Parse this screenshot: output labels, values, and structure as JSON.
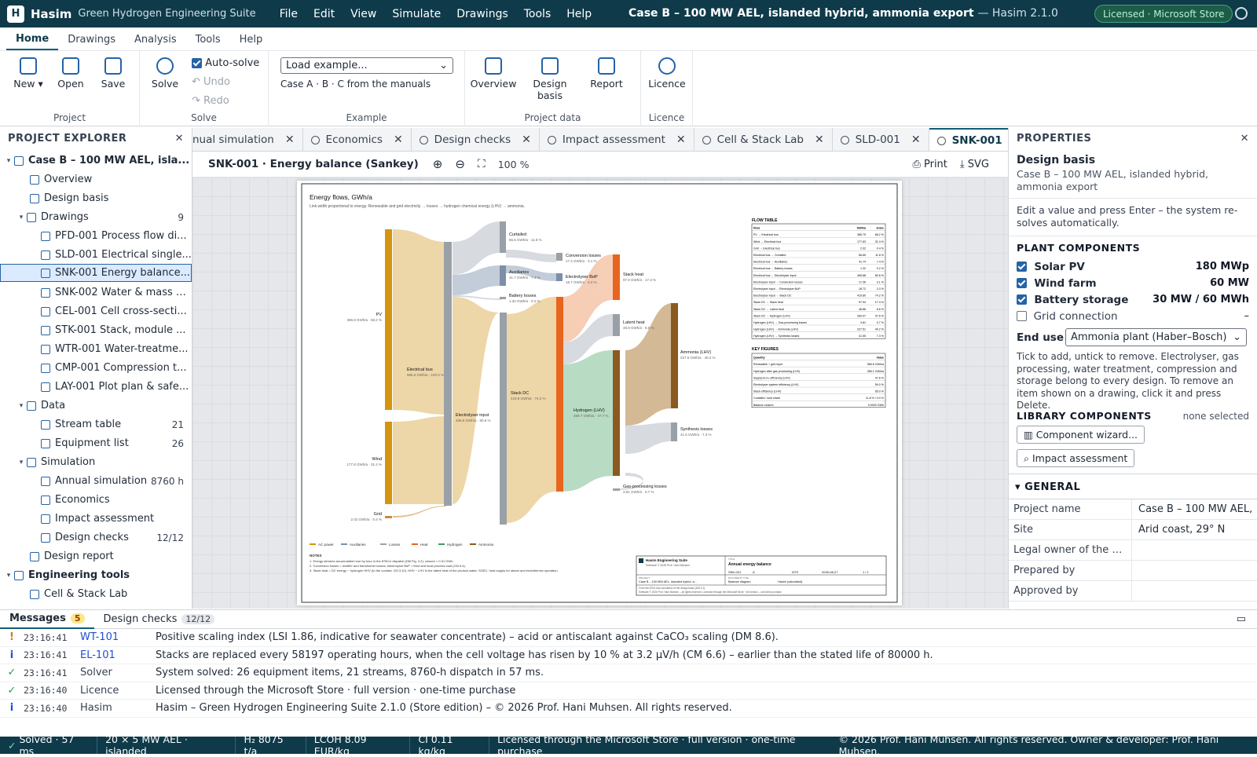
{
  "app": {
    "logo_letter": "H",
    "name": "Hasim",
    "subtitle": "Green Hydrogen Engineering Suite",
    "window_title": "Case B – 100 MW AEL, islanded hybrid, ammonia export",
    "version": "— Hasim 2.1.0",
    "license_badge": "Licensed · Microsoft Store"
  },
  "menu": [
    "File",
    "Edit",
    "View",
    "Simulate",
    "Drawings",
    "Tools",
    "Help"
  ],
  "ribbon_tabs": [
    "Home",
    "Drawings",
    "Analysis",
    "Tools",
    "Help"
  ],
  "ribbon": {
    "project": {
      "label": "Project",
      "new": "New ▾",
      "open": "Open",
      "save": "Save"
    },
    "solve": {
      "label": "Solve",
      "solve": "Solve",
      "autosolve": "Auto-solve",
      "undo": "Undo",
      "redo": "Redo"
    },
    "example": {
      "label": "Example",
      "select": "Load example...",
      "hint": "Case A · B · C from the manuals"
    },
    "project_data": {
      "label": "Project data",
      "overview": "Overview",
      "design_basis": "Design basis",
      "report": "Report"
    },
    "licence": {
      "label": "Licence",
      "licence": "Licence"
    }
  },
  "explorer": {
    "title": "PROJECT EXPLORER",
    "root": "Case B – 100 MW AEL, isla...",
    "items": [
      {
        "label": "Overview",
        "count": ""
      },
      {
        "label": "Design basis",
        "count": ""
      },
      {
        "label": "Drawings",
        "count": "9"
      },
      {
        "label": "PFD-001 Process flow di...",
        "count": ""
      },
      {
        "label": "SLD-001 Electrical single...",
        "count": ""
      },
      {
        "label": "SNK-001 Energy balance...",
        "count": ""
      },
      {
        "label": "SNK-002 Water & mass b...",
        "count": ""
      },
      {
        "label": "CEL-001 Cell cross-secti...",
        "count": ""
      },
      {
        "label": "STK-001 Stack, module ...",
        "count": ""
      },
      {
        "label": "WTR-001 Water-treatme...",
        "count": ""
      },
      {
        "label": "CMP-001 Compression t...",
        "count": ""
      },
      {
        "label": "LAY-001 Plot plan & safe...",
        "count": ""
      },
      {
        "label": "Data",
        "count": ""
      },
      {
        "label": "Stream table",
        "count": "21"
      },
      {
        "label": "Equipment list",
        "count": "26"
      },
      {
        "label": "Simulation",
        "count": ""
      },
      {
        "label": "Annual simulation",
        "count": "8760 h"
      },
      {
        "label": "Economics",
        "count": ""
      },
      {
        "label": "Impact assessment",
        "count": ""
      },
      {
        "label": "Design checks",
        "count": "12/12"
      },
      {
        "label": "Design report",
        "count": ""
      },
      {
        "label": "Engineering tools",
        "count": ""
      },
      {
        "label": "Cell & Stack Lab",
        "count": ""
      }
    ]
  },
  "doc_tabs": [
    {
      "label": "nual simulation"
    },
    {
      "label": "Economics"
    },
    {
      "label": "Design checks"
    },
    {
      "label": "Impact assessment"
    },
    {
      "label": "Cell & Stack Lab"
    },
    {
      "label": "SLD-001"
    },
    {
      "label": "SNK-001"
    }
  ],
  "doc_toolbar": {
    "title": "SNK-001 · Energy balance (Sankey)",
    "zoom": "100 %",
    "print": "Print",
    "svg": "SVG"
  },
  "sankey": {
    "title": "Energy flows, GWh/a",
    "subtitle": "Link width proportional to energy. Renewable and grid electricity → losses → hydrogen chemical energy (LHV) → ammonia.",
    "nodes": [
      {
        "name": "PV",
        "value": "385.8 GWh/a · 68.2 %"
      },
      {
        "name": "Wind",
        "value": "177.8 GWh/a · 31.4 %"
      },
      {
        "name": "Grid",
        "value": "2.02 GWh/a · 0.4 %"
      },
      {
        "name": "Electrical bus",
        "value": "565.6 GWh/a · 100.0 %"
      },
      {
        "name": "Curtailed",
        "value": "66.6 GWh/a · 11.8 %"
      },
      {
        "name": "Auxiliaries",
        "value": "41.7 GWh/a · 7.4 %"
      },
      {
        "name": "Battery losses",
        "value": "1.32 GWh/a · 0.2 %"
      },
      {
        "name": "Electrolyser input",
        "value": "455.9 GWh/a · 80.6 %"
      },
      {
        "name": "Conversion losses",
        "value": "17.4 GWh/a · 3.1 %"
      },
      {
        "name": "Electrolyser BoP",
        "value": "18.7 GWh/a · 3.3 %"
      },
      {
        "name": "Stack DC",
        "value": "419.8 GWh/a · 74.2 %"
      },
      {
        "name": "Stack heat",
        "value": "97.9 GWh/a · 17.3 %"
      },
      {
        "name": "Latent heat",
        "value": "48.9 GWh/a · 8.6 %"
      },
      {
        "name": "Hydrogen (LHV)",
        "value": "269.7 GWh/a · 47.7 %"
      },
      {
        "name": "Ammonia (LHV)",
        "value": "227.5 GWh/a · 40.2 %"
      },
      {
        "name": "Synthesis losses",
        "value": "41.6 GWh/a · 7.3 %"
      },
      {
        "name": "Gas-processing losses",
        "value": "3.81 GWh/a · 0.7 %"
      }
    ],
    "legend": [
      "AC power",
      "Auxiliaries",
      "Losses",
      "Heat",
      "Hydrogen",
      "Ammonia"
    ],
    "notes_title": "NOTES",
    "notes": [
      "1. Energy streams accumulated hour by hour in the 8760-h dispatch (DM Fig. 4.2); closure = 0.01 GWh.",
      "2. Conversion losses = rectifier and transformer losses; electrolyser BoP = feed and local process load (CM 6.4).",
      "3. Stack heat = DC energy − hydrogen HHV (to the coolant; CM 3.10). HHV − LHV is the latent heat of the product water; SOEC: heat supply for steam and endothermic operation."
    ],
    "flow_table_title": "FLOW TABLE",
    "flow_headers": [
      "Flow",
      "GWh/a",
      "share"
    ],
    "flows": [
      [
        "PV → Electrical bus",
        "385.75",
        "68.2 %"
      ],
      [
        "Wind → Electrical bus",
        "177.83",
        "31.4 %"
      ],
      [
        "Grid → Electrical bus",
        "2.02",
        "0.4 %"
      ],
      [
        "Electrical bus → Curtailed",
        "66.65",
        "11.8 %"
      ],
      [
        "Electrical bus → Auxiliaries",
        "41.74",
        "7.4 %"
      ],
      [
        "Electrical bus → Battery losses",
        "1.32",
        "0.2 %"
      ],
      [
        "Electrical bus → Electrolyser input",
        "455.88",
        "80.6 %"
      ],
      [
        "Electrolyser input → Conversion losses",
        "17.36",
        "3.1 %"
      ],
      [
        "Electrolyser input → Electrolyser BoP",
        "18.72",
        "3.3 %"
      ],
      [
        "Electrolyser input → Stack DC",
        "419.80",
        "74.2 %"
      ],
      [
        "Stack DC → Stack heat",
        "97.94",
        "17.3 %"
      ],
      [
        "Stack DC → Latent heat",
        "48.88",
        "8.6 %"
      ],
      [
        "Stack DC → Hydrogen (LHV)",
        "269.07",
        "47.6 %"
      ],
      [
        "Hydrogen (LHV) → Gas-processing losses",
        "3.81",
        "0.7 %"
      ],
      [
        "Hydrogen (LHV) → Ammonia (LHV)",
        "227.51",
        "40.2 %"
      ],
      [
        "Hydrogen (LHV) → Synthesis losses",
        "41.55",
        "7.3 %"
      ]
    ],
    "kf_title": "KEY FIGURES",
    "kf_headers": [
      "Quantity",
      "Value"
    ],
    "key_figures": [
      [
        "Renewable + grid input",
        "565.6 GWh/a"
      ],
      [
        "Hydrogen after gas processing (LHV)",
        "265.1 GWh/a"
      ],
      [
        "Supply-to-H₂ efficiency (LHV)",
        "47.6 %"
      ],
      [
        "Electrolyser system efficiency (LHV)",
        "59.0 %"
      ],
      [
        "Stack efficiency (LHV)",
        "65.0 %"
      ],
      [
        "Curtailed / sold share",
        "11.8 % / 0.0 %"
      ],
      [
        "Balance closure",
        "0.0000 GWh"
      ]
    ],
    "titleblock": {
      "company": "Hasim Engineering Suite",
      "software": "Software © 2026 Prof. Hani Muhsen",
      "title_label": "TITLE",
      "title": "Annual energy balance",
      "project_label": "PROJECT",
      "project": "Case B – 100 MW AEL, islanded hybrid, a...",
      "doc_label": "DOCUMENT TYPE",
      "doc": "Balance diagram",
      "drawing": "SNK-001",
      "rev": "A",
      "scale": "NTS",
      "date": "2026-08-27",
      "sheet": "1 / 1",
      "created": "Hasim (calculated)",
      "footer": "From the 8760-hour simulation of the design basis (DM 4.2).",
      "footer2": "Software © 2026 Prof. Hani Muhsen – all rights reserved. Licensed through the Microsoft Store · full version – one-time purchase"
    }
  },
  "properties": {
    "title": "PROPERTIES",
    "heading": "Design basis",
    "sub": "Case B – 100 MW AEL, islanded hybrid, ammonia export",
    "hint": "Edit a value and press Enter – the system re-solves automatically.",
    "plant_title": "PLANT COMPONENTS",
    "components": [
      {
        "label": "Solar PV",
        "value": "180 MWp",
        "checked": true
      },
      {
        "label": "Wind farm",
        "value": "60 MW",
        "checked": true
      },
      {
        "label": "Battery storage",
        "value": "30 MW / 60 MWh",
        "checked": true
      },
      {
        "label": "Grid connection",
        "value": "–",
        "checked": false
      }
    ],
    "end_use_label": "End use",
    "end_use": "Ammonia plant (Haber–Bosch)",
    "tick_hint": "Tick to add, untick to remove. Electrolyser, gas processing, water treatment, compression and storage belong to every design. To remove an item shown on a drawing, click it and press Delete.",
    "lib_title": "LIBRARY COMPONENTS",
    "lib_none": "none selected",
    "wizard": "Component wizard...",
    "impact": "Impact assessment",
    "general_title": "GENERAL",
    "general": [
      {
        "k": "Project name",
        "v": "Case B – 100 MW AEL,"
      },
      {
        "k": "Site",
        "v": "Arid coast, 29° N"
      },
      {
        "k": "Legal owner of the d...",
        "v": ""
      },
      {
        "k": "Prepared by",
        "v": ""
      },
      {
        "k": "Approved by",
        "v": ""
      }
    ]
  },
  "messages": {
    "tab1": "Messages",
    "tab1_count": "5",
    "tab2": "Design checks",
    "tab2_count": "12/12",
    "rows": [
      {
        "level": "!",
        "time": "23:16:41",
        "src": "WT-101",
        "text": "Positive scaling index (LSI 1.86, indicative for seawater concentrate) – acid or antiscalant against CaCO₃ scaling (DM 8.6)."
      },
      {
        "level": "i",
        "time": "23:16:41",
        "src": "EL-101",
        "text": "Stacks are replaced every 58197 operating hours, when the cell voltage has risen by 10 % at 3.2 µV/h (CM 6.6) – earlier than the stated life of 80000 h."
      },
      {
        "level": "✓",
        "time": "23:16:41",
        "src": "Solver",
        "text": "System solved: 26 equipment items, 21 streams, 8760-h dispatch in 57 ms."
      },
      {
        "level": "✓",
        "time": "23:16:40",
        "src": "Licence",
        "text": "Licensed through the Microsoft Store · full version · one-time purchase"
      },
      {
        "level": "i",
        "time": "23:16:40",
        "src": "Hasim",
        "text": "Hasim – Green Hydrogen Engineering Suite 2.1.0 (Store edition) – © 2026 Prof. Hani Muhsen. All rights reserved."
      }
    ]
  },
  "status": {
    "solved": "Solved · 57 ms",
    "config": "20 × 5 MW AEL · islanded",
    "h2": "H₂ 8075 t/a",
    "lcoh": "LCOH 8.09 EUR/kg",
    "ci": "CI 0.11 kg/kg",
    "lic": "Licensed through the Microsoft Store · full version · one-time purchase",
    "copyright": "© 2026 Prof. Hani Muhsen. All rights reserved. Owner & developer: Prof. Hani Muhsen."
  }
}
